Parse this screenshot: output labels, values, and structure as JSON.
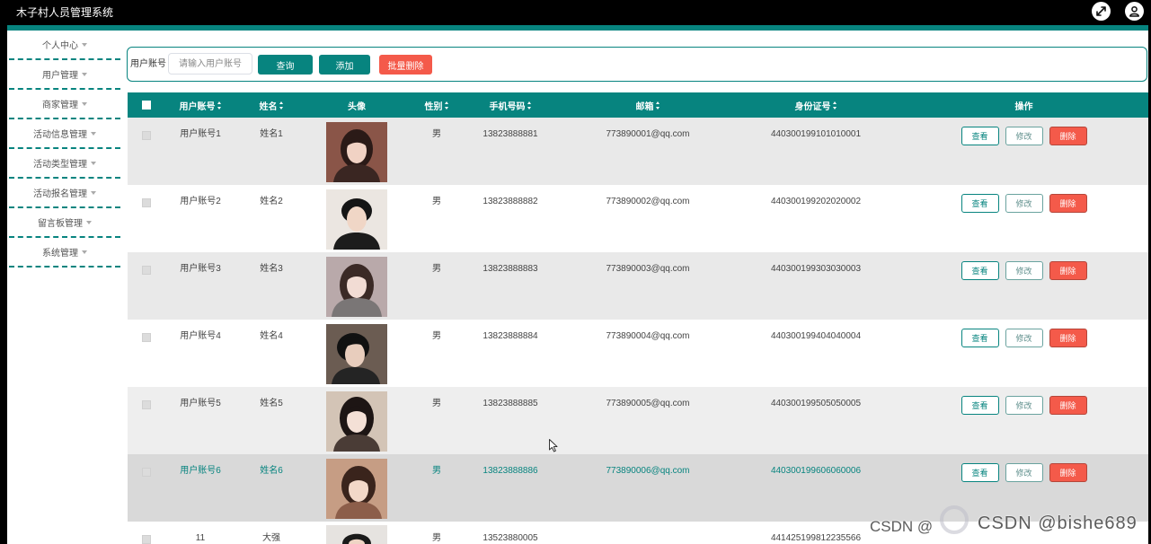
{
  "app": {
    "title": "木子村人员管理系统"
  },
  "header": {
    "icons": [
      "fullscreen-icon",
      "user-icon"
    ]
  },
  "theme": {
    "accent": "#07847f",
    "danger": "#f45a4a",
    "header_bg": "#000000"
  },
  "sidebar": {
    "items": [
      {
        "label": "个人中心",
        "icon": "chevron-down-icon"
      },
      {
        "label": "用户管理",
        "icon": "chevron-down-icon"
      },
      {
        "label": "商家管理",
        "icon": "chevron-down-icon"
      },
      {
        "label": "活动信息管理",
        "icon": "chevron-down-icon"
      },
      {
        "label": "活动类型管理",
        "icon": "chevron-down-icon"
      },
      {
        "label": "活动报名管理",
        "icon": "chevron-down-icon"
      },
      {
        "label": "留言板管理",
        "icon": "chevron-down-icon"
      },
      {
        "label": "系统管理",
        "icon": "chevron-down-icon"
      }
    ]
  },
  "search": {
    "label": "用户账号",
    "placeholder": "请输入用户账号",
    "query_button": "查询",
    "add_button": "添加",
    "batch_delete_button": "批量删除"
  },
  "table": {
    "columns": [
      "用户账号",
      "姓名",
      "头像",
      "性别",
      "手机号码",
      "邮箱",
      "身份证号",
      "操作"
    ],
    "actions": {
      "view": "查看",
      "edit": "修改",
      "delete": "删除"
    },
    "highlighted_row": 5,
    "rows": [
      {
        "account": "用户账号1",
        "name": "姓名1",
        "gender": "男",
        "phone": "13823888881",
        "email": "773890001@qq.com",
        "id_number": "440300199101010001"
      },
      {
        "account": "用户账号2",
        "name": "姓名2",
        "gender": "男",
        "phone": "13823888882",
        "email": "773890002@qq.com",
        "id_number": "440300199202020002"
      },
      {
        "account": "用户账号3",
        "name": "姓名3",
        "gender": "男",
        "phone": "13823888883",
        "email": "773890003@qq.com",
        "id_number": "440300199303030003"
      },
      {
        "account": "用户账号4",
        "name": "姓名4",
        "gender": "男",
        "phone": "13823888884",
        "email": "773890004@qq.com",
        "id_number": "440300199404040004"
      },
      {
        "account": "用户账号5",
        "name": "姓名5",
        "gender": "男",
        "phone": "13823888885",
        "email": "773890005@qq.com",
        "id_number": "440300199505050005"
      },
      {
        "account": "用户账号6",
        "name": "姓名6",
        "gender": "男",
        "phone": "13823888886",
        "email": "773890006@qq.com",
        "id_number": "440300199606060006"
      },
      {
        "account": "11",
        "name": "大强",
        "gender": "男",
        "phone": "13523880005",
        "id_number": "441425199812235566"
      }
    ]
  },
  "watermark": {
    "text_1": "CSDN @",
    "text_2": "CSDN @bishe689"
  }
}
